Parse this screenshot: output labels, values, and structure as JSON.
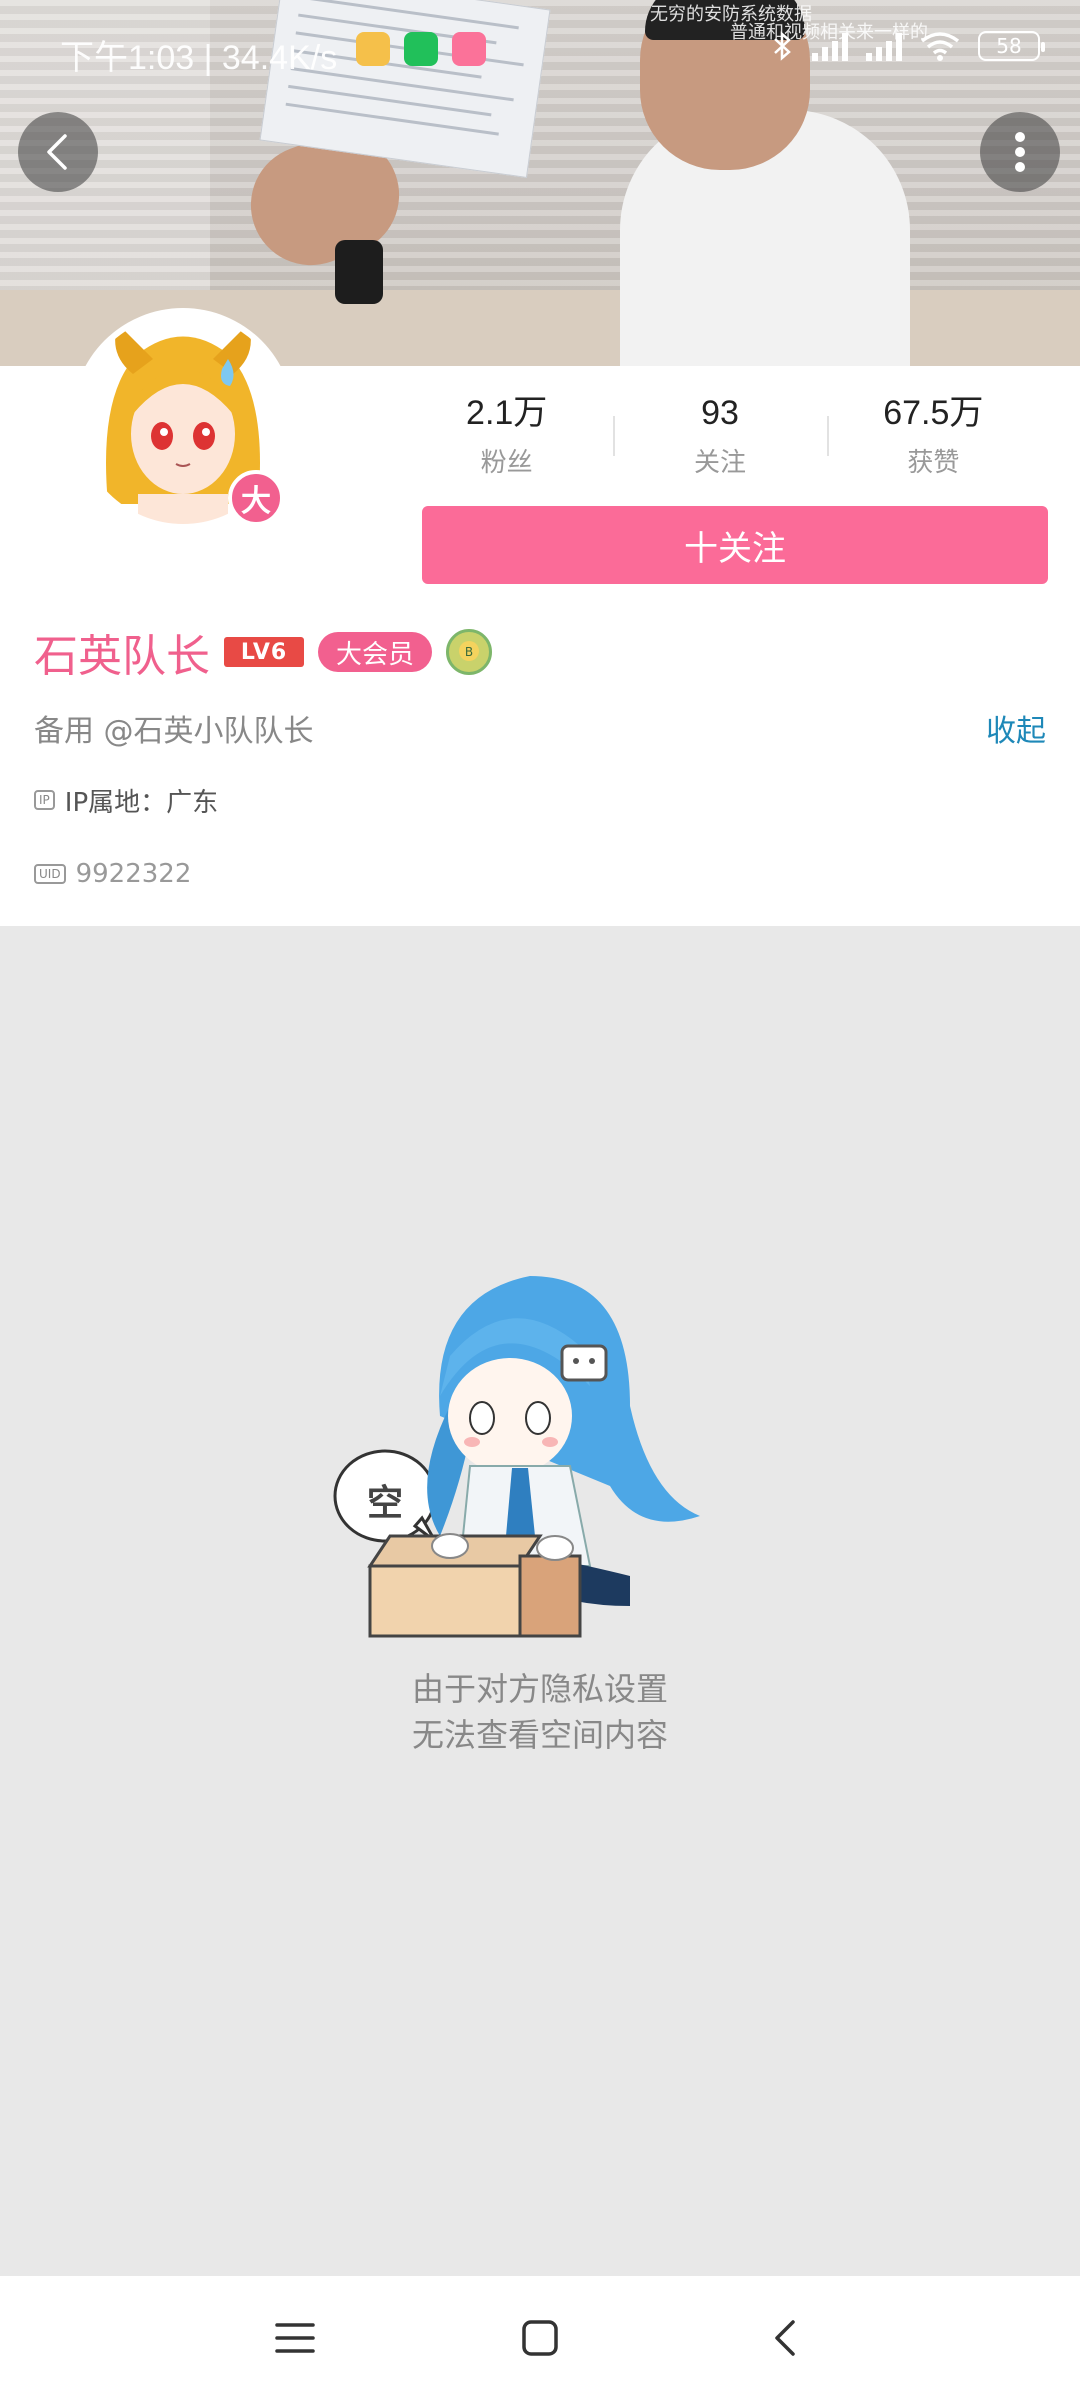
{
  "status_bar": {
    "time": "下午1:03 | 34.4K/s",
    "battery": "58",
    "overlay_lines": [
      "无穷的安防系统数据",
      "普通和视频相关来一样的"
    ]
  },
  "header": {
    "back_icon": "chevron-left-icon",
    "more_icon": "more-vertical-icon"
  },
  "profile": {
    "avatar_badge": "大",
    "stats": [
      {
        "value": "2.1万",
        "label": "粉丝"
      },
      {
        "value": "93",
        "label": "关注"
      },
      {
        "value": "67.5万",
        "label": "获赞"
      }
    ],
    "follow_button": "十关注",
    "name": "石英队长",
    "level_badge": "LV6",
    "vip_badge": "大会员",
    "signature": "备用 @石英小队队长",
    "collapse_link": "收起",
    "ip_tag": "IP",
    "ip_location": "IP属地：广东",
    "uid_tag": "UID",
    "uid": "9922322"
  },
  "empty_state": {
    "bubble_text": "空",
    "line1": "由于对方隐私设置",
    "line2": "无法查看空间内容"
  },
  "colors": {
    "accent_pink": "#fb6b98",
    "name_pink": "#f0608d",
    "link_blue": "#1e88b8"
  }
}
